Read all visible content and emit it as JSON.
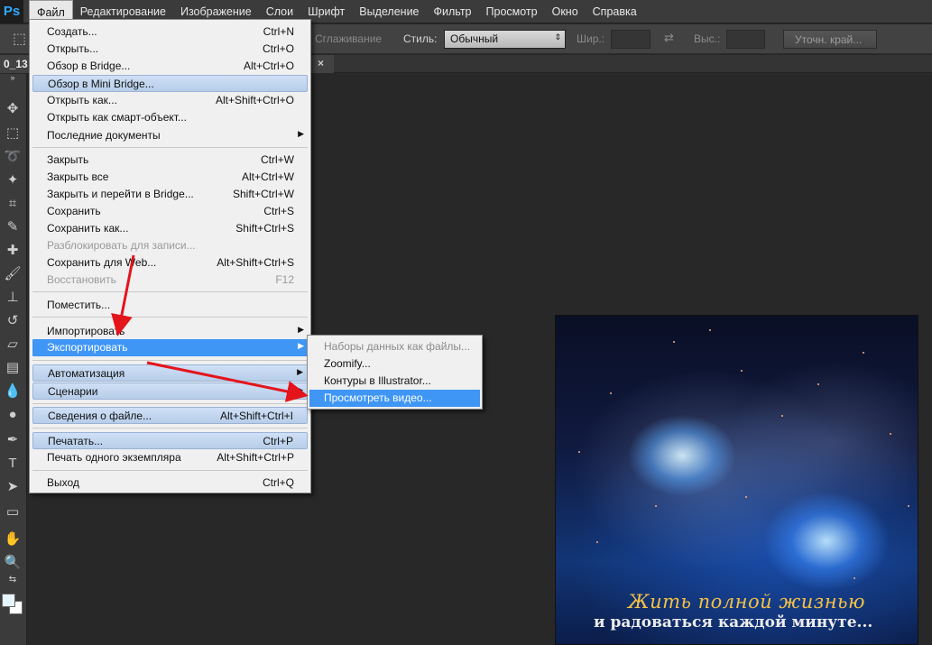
{
  "app": {
    "logo": "Ps"
  },
  "menubar": {
    "items": [
      "Файл",
      "Редактирование",
      "Изображение",
      "Слои",
      "Шрифт",
      "Выделение",
      "Фильтр",
      "Просмотр",
      "Окно",
      "Справка"
    ],
    "active": "Файл"
  },
  "options": {
    "antialias": "Сглаживание",
    "style_label": "Стиль:",
    "style_value": "Обычный",
    "width_label": "Шир.:",
    "height_label": "Выс.:",
    "refine_button": "Уточн. край..."
  },
  "document": {
    "tab_title": "0_13",
    "close": "×"
  },
  "file_menu": {
    "items": [
      {
        "label": "Создать...",
        "shortcut": "Ctrl+N"
      },
      {
        "label": "Открыть...",
        "shortcut": "Ctrl+O"
      },
      {
        "label": "Обзор в Bridge...",
        "shortcut": "Alt+Ctrl+O"
      },
      {
        "label": "Обзор в Mini Bridge...",
        "shortcut": ""
      },
      {
        "label": "Открыть как...",
        "shortcut": "Alt+Shift+Ctrl+O"
      },
      {
        "label": "Открыть как смарт-объект...",
        "shortcut": ""
      },
      {
        "label": "Последние документы",
        "shortcut": ""
      },
      {
        "label": "Закрыть",
        "shortcut": "Ctrl+W"
      },
      {
        "label": "Закрыть все",
        "shortcut": "Alt+Ctrl+W"
      },
      {
        "label": "Закрыть и перейти в Bridge...",
        "shortcut": "Shift+Ctrl+W"
      },
      {
        "label": "Сохранить",
        "shortcut": "Ctrl+S"
      },
      {
        "label": "Сохранить как...",
        "shortcut": "Shift+Ctrl+S"
      },
      {
        "label": "Разблокировать для записи...",
        "shortcut": ""
      },
      {
        "label": "Сохранить для Web...",
        "shortcut": "Alt+Shift+Ctrl+S"
      },
      {
        "label": "Восстановить",
        "shortcut": "F12"
      },
      {
        "label": "Поместить...",
        "shortcut": ""
      },
      {
        "label": "Импортировать",
        "shortcut": ""
      },
      {
        "label": "Экспортировать",
        "shortcut": ""
      },
      {
        "label": "Автоматизация",
        "shortcut": ""
      },
      {
        "label": "Сценарии",
        "shortcut": ""
      },
      {
        "label": "Сведения о файле...",
        "shortcut": "Alt+Shift+Ctrl+I"
      },
      {
        "label": "Печатать...",
        "shortcut": "Ctrl+P"
      },
      {
        "label": "Печать одного экземпляра",
        "shortcut": "Alt+Shift+Ctrl+P"
      },
      {
        "label": "Выход",
        "shortcut": "Ctrl+Q"
      }
    ]
  },
  "export_submenu": {
    "items": [
      {
        "label": "Наборы данных как файлы..."
      },
      {
        "label": "Zoomify..."
      },
      {
        "label": "Контуры в Illustrator..."
      },
      {
        "label": "Просмотреть видео..."
      }
    ]
  },
  "canvas": {
    "caption_line1": "Жить полной жизнью",
    "caption_line2": "и радоваться каждой минуте..."
  },
  "colors": {
    "menu_highlight": "#3f96f5",
    "arrow": "#e4141b",
    "ps_blue": "#31a8ff"
  }
}
